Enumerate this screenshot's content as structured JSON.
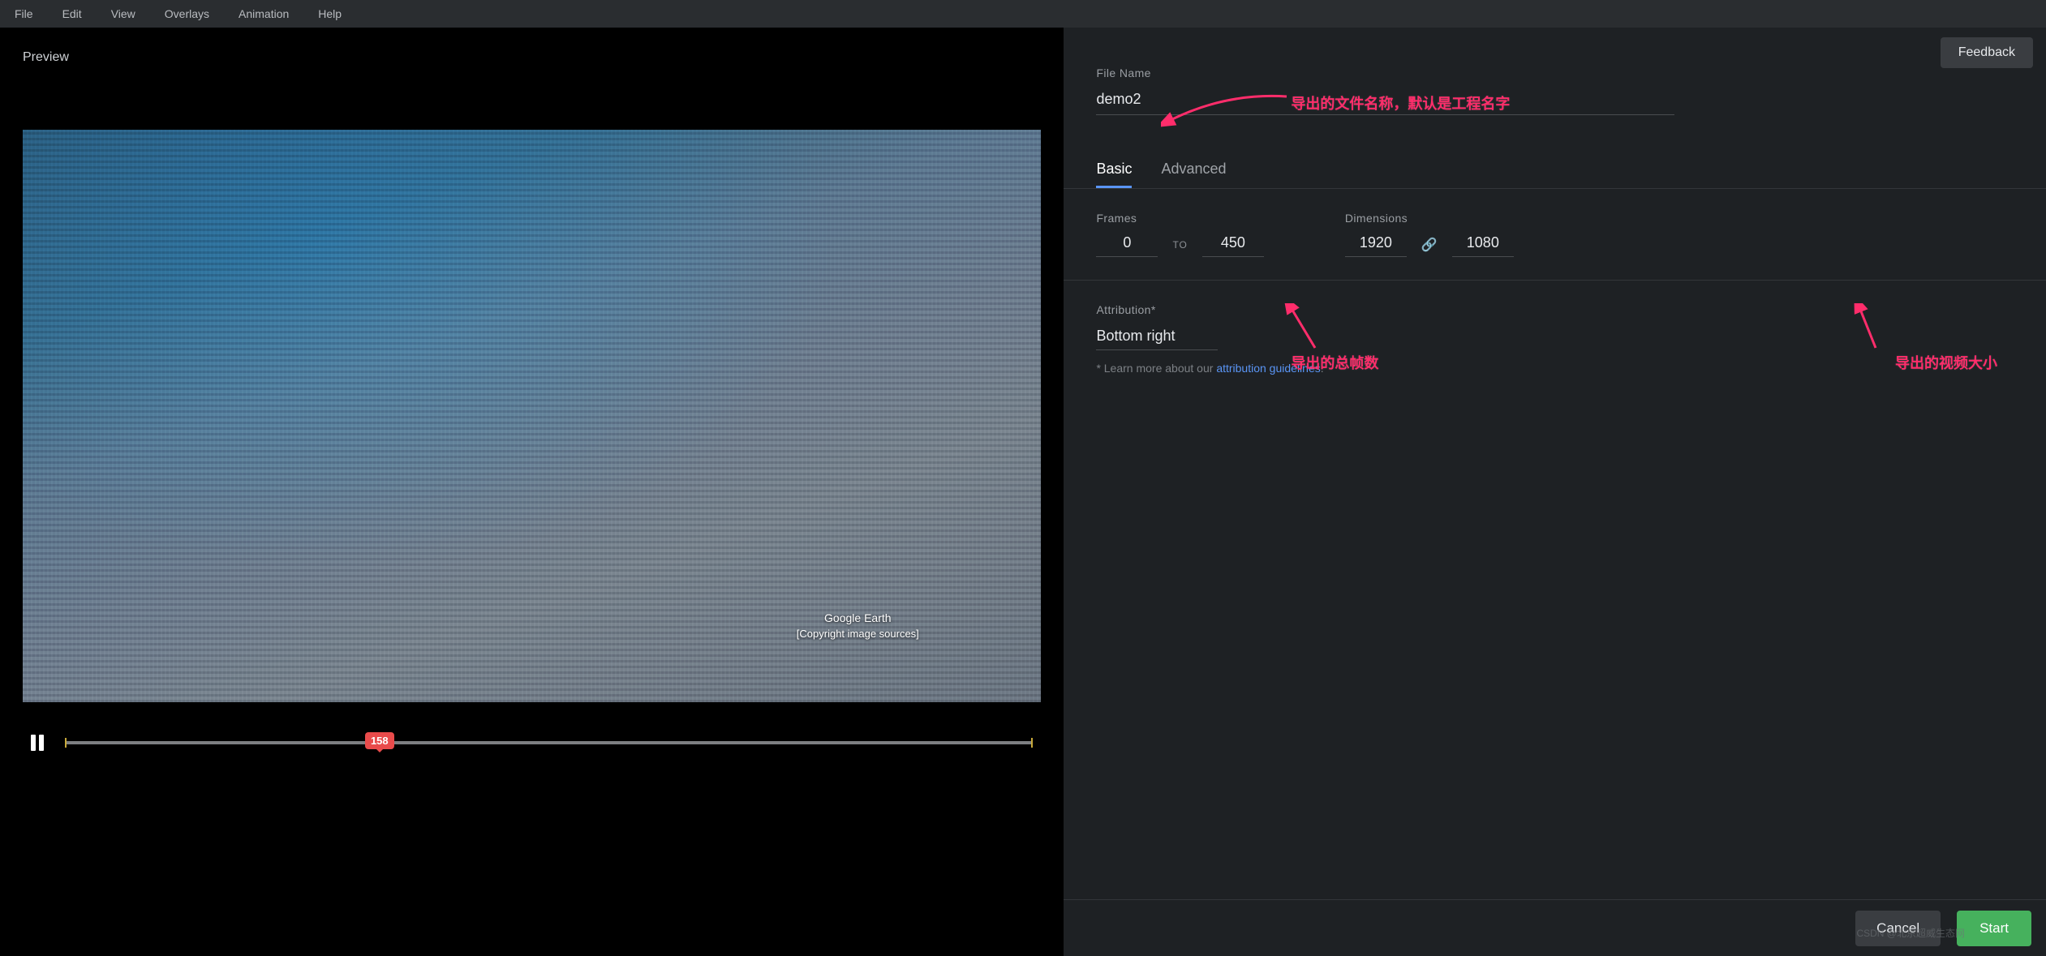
{
  "menu": {
    "items": [
      "File",
      "Edit",
      "View",
      "Overlays",
      "Animation",
      "Help"
    ]
  },
  "left": {
    "preview_label": "Preview",
    "watermark_brand": "Google Earth",
    "watermark_copyright": "[Copyright image sources]",
    "playhead": "158"
  },
  "right": {
    "feedback": "Feedback",
    "file_name_label": "File Name",
    "file_name_value": "demo2",
    "tabs": {
      "basic": "Basic",
      "advanced": "Advanced"
    },
    "frames": {
      "label": "Frames",
      "from": "0",
      "to_sep": "TO",
      "to": "450"
    },
    "dimensions": {
      "label": "Dimensions",
      "w": "1920",
      "h": "1080"
    },
    "attribution": {
      "label": "Attribution*",
      "value": "Bottom right",
      "help_prefix": "* Learn more about our ",
      "help_link": "attribution guidelines"
    },
    "footer": {
      "cancel": "Cancel",
      "start": "Start"
    },
    "csdn": "CSDN @北京超威生态网"
  },
  "annotations": {
    "a1": "导出的文件名称，默认是工程名字",
    "a2": "导出的总帧数",
    "a3": "导出的视频大小"
  }
}
